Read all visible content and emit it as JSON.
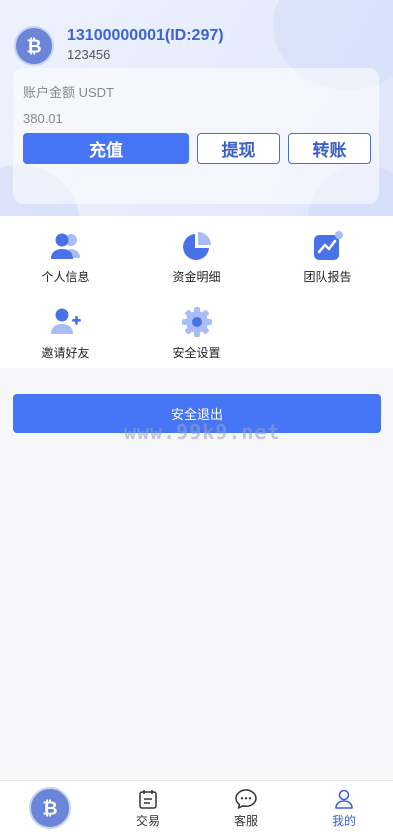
{
  "profile": {
    "phone_id": "13100000001(ID:297)",
    "username": "123456"
  },
  "balance": {
    "label": "账户金额 USDT",
    "value": "380.01"
  },
  "actions": {
    "recharge": "充值",
    "withdraw": "提现",
    "transfer": "转账"
  },
  "menu": {
    "items": [
      {
        "label": "个人信息",
        "icon": "user-group-icon"
      },
      {
        "label": "资金明细",
        "icon": "pie-chart-icon"
      },
      {
        "label": "团队报告",
        "icon": "trend-chart-icon"
      },
      {
        "label": "邀请好友",
        "icon": "user-add-icon"
      },
      {
        "label": "安全设置",
        "icon": "gear-icon"
      }
    ]
  },
  "logout": {
    "label": "安全退出"
  },
  "watermark": "www.99k9.net",
  "tabbar": {
    "items": [
      {
        "label": "",
        "icon": "bitcoin-coin-icon"
      },
      {
        "label": "交易",
        "icon": "calendar-list-icon"
      },
      {
        "label": "客服",
        "icon": "chat-bubble-icon"
      },
      {
        "label": "我的",
        "icon": "person-icon",
        "active": true
      }
    ]
  },
  "colors": {
    "accent": "#4676f6",
    "title": "#3c63d6",
    "icon": "#4a72e8"
  }
}
